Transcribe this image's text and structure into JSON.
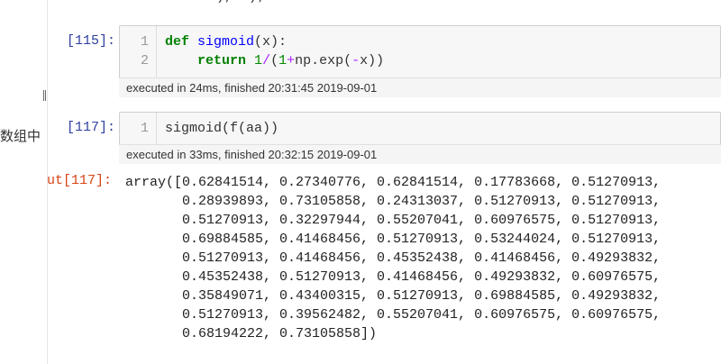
{
  "top_fragment": "), '); ",
  "side_text": "数组中",
  "cells": [
    {
      "prompt": "[115]:",
      "lines": [
        {
          "no": "1",
          "tokens": [
            [
              "kw",
              "def"
            ],
            [
              "plain",
              " "
            ],
            [
              "fn",
              "sigmoid"
            ],
            [
              "plain",
              "(x):"
            ]
          ]
        },
        {
          "no": "2",
          "tokens": [
            [
              "plain",
              "    "
            ],
            [
              "kw",
              "return"
            ],
            [
              "plain",
              " "
            ],
            [
              "num",
              "1"
            ],
            [
              "op",
              "/"
            ],
            [
              "plain",
              "("
            ],
            [
              "num",
              "1"
            ],
            [
              "op",
              "+"
            ],
            [
              "plain",
              "np.exp("
            ],
            [
              "op",
              "-"
            ],
            [
              "plain",
              "x))"
            ]
          ]
        }
      ],
      "exec": "executed in 24ms, finished 20:31:45 2019-09-01"
    },
    {
      "prompt": "[117]:",
      "lines": [
        {
          "no": "1",
          "tokens": [
            [
              "plain",
              "sigmoid(f(aa))"
            ]
          ]
        }
      ],
      "exec": "executed in 33ms, finished 20:32:15 2019-09-01"
    }
  ],
  "output": {
    "prompt": "ut[117]:",
    "lines": [
      "array([0.62841514, 0.27340776, 0.62841514, 0.17783668, 0.51270913,",
      "       0.28939893, 0.73105858, 0.24313037, 0.51270913, 0.51270913,",
      "       0.51270913, 0.32297944, 0.55207041, 0.60976575, 0.51270913,",
      "       0.69884585, 0.41468456, 0.51270913, 0.53244024, 0.51270913,",
      "       0.51270913, 0.41468456, 0.45352438, 0.41468456, 0.49293832,",
      "       0.45352438, 0.51270913, 0.41468456, 0.49293832, 0.60976575,",
      "       0.35849071, 0.43400315, 0.51270913, 0.69884585, 0.49293832,",
      "       0.51270913, 0.39562482, 0.55207041, 0.60976575, 0.60976575,",
      "       0.68194222, 0.73105858])"
    ]
  }
}
